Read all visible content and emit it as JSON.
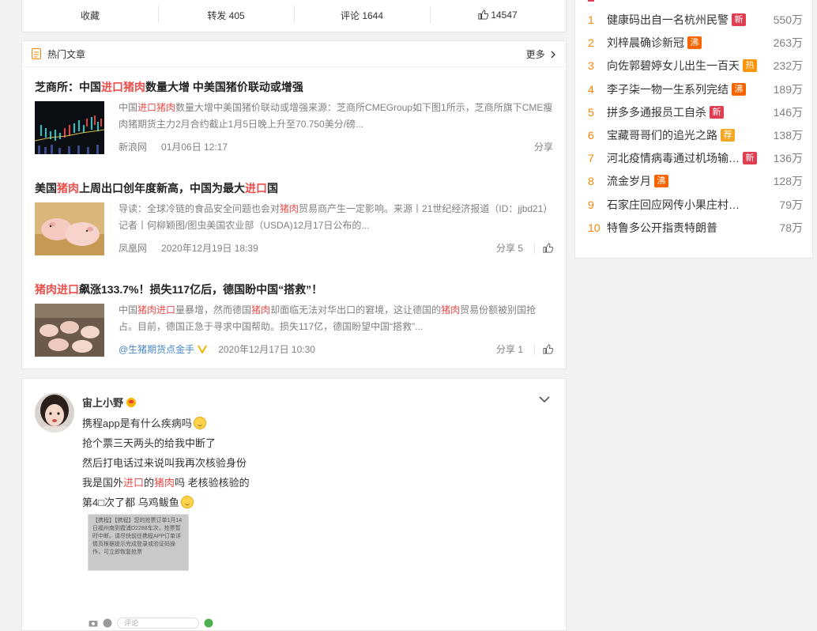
{
  "action_bar": {
    "collect": "收藏",
    "forward": "转发 405",
    "comment": "评论 1644",
    "like": "14547"
  },
  "hot_articles": {
    "title": "热门文章",
    "more": "更多",
    "items": [
      {
        "title_parts": [
          "芝商所：中国",
          "进口猪肉",
          "数量大增 中美国猪价联动或增强"
        ],
        "summary_parts": [
          "中国",
          "进口猪肉",
          "数量大增中美国猪价联动或增强来源：芝商所CMEGroup如下图1所示，芝商所旗下CME瘦肉猪期货主力2月合约截止1月5日晚上升至70.750美分/磅..."
        ],
        "source": "新浪网",
        "time": "01月06日 12:17",
        "share": "分享"
      },
      {
        "title_parts": [
          "美国",
          "猪肉",
          "上周出口创年度新高，中国为最大",
          "进口",
          "国"
        ],
        "summary_parts": [
          "导读：全球冷链的食品安全问题也会对",
          "猪肉",
          "贸易商产生一定影响。来源丨21世纪经济报道（ID：jjbd21）记者丨何柳颖图/图虫美国农业部（USDA)12月17日公布的..."
        ],
        "source": "凤凰网",
        "time": "2020年12月19日 18:39",
        "share": "分享 5"
      },
      {
        "title_parts": [
          "猪肉进口",
          "飙涨133.7%！损失117亿后，德国盼中国“搭救”！"
        ],
        "summary_parts": [
          "中国",
          "猪肉进口",
          "量暴增，然而德国",
          "猪肉",
          "却面临无法对华出口的窘境，这让德国的",
          "猪肉",
          "贸易份额被别国抢占。目前，德国正急于寻求中国帮助。损失117亿，德国盼望中国“搭救”..."
        ],
        "source": "@生猪期货点金手",
        "time": "2020年12月17日 10:30",
        "share": "分享 1"
      }
    ]
  },
  "post": {
    "username": "宙上小野",
    "lines": [
      {
        "parts": [
          "携程app是有什么疾病吗"
        ]
      },
      {
        "parts": [
          "抢个票三天两头的给我中断了"
        ]
      },
      {
        "parts": [
          "然后打电话过来说叫我再次核验身份"
        ]
      },
      {
        "parts": [
          "我是国外",
          "进口",
          "的",
          "猪肉",
          "吗 老核验核验的"
        ]
      },
      {
        "parts": [
          "第4□次了都 乌鸡鲅鱼"
        ]
      }
    ],
    "image_text": "【携程】【携程】您的抢票订单1月14日福州南到霞浦D2288车次，抢票暂时中断。请尽快前往携程APP订单详情页根据提示完成登录或验证码操作，可立即恢复抢票",
    "comment_placeholder": "评论"
  },
  "hot_search": {
    "items": [
      {
        "num": "1",
        "title": "健康码出自一名杭州民警",
        "badge": "新",
        "badge_color": "#e13d52",
        "count": "550万"
      },
      {
        "num": "2",
        "title": "刘梓晨确诊新冠",
        "badge": "沸",
        "badge_color": "#f86400",
        "count": "263万"
      },
      {
        "num": "3",
        "title": "向佐郭碧婷女儿出生一百天",
        "badge": "热",
        "badge_color": "#ff9406",
        "count": "232万"
      },
      {
        "num": "4",
        "title": "李子柒一物一生系列完结",
        "badge": "沸",
        "badge_color": "#f86400",
        "count": "189万"
      },
      {
        "num": "5",
        "title": "拼多多通报员工自杀",
        "badge": "新",
        "badge_color": "#e13d52",
        "count": "146万"
      },
      {
        "num": "6",
        "title": "宝藏哥哥们的追光之路",
        "badge": "荐",
        "badge_color": "#f5a623",
        "count": "138万"
      },
      {
        "num": "7",
        "title": "河北疫情病毒通过机场输…",
        "badge": "新",
        "badge_color": "#e13d52",
        "count": "136万"
      },
      {
        "num": "8",
        "title": "流金岁月",
        "badge": "沸",
        "badge_color": "#f86400",
        "count": "128万"
      },
      {
        "num": "9",
        "title": "石家庄回应网传小果庄村…",
        "badge": "",
        "badge_color": "",
        "count": "79万"
      },
      {
        "num": "10",
        "title": "特鲁多公开指责特朗普",
        "badge": "",
        "badge_color": "",
        "count": "78万"
      }
    ]
  }
}
